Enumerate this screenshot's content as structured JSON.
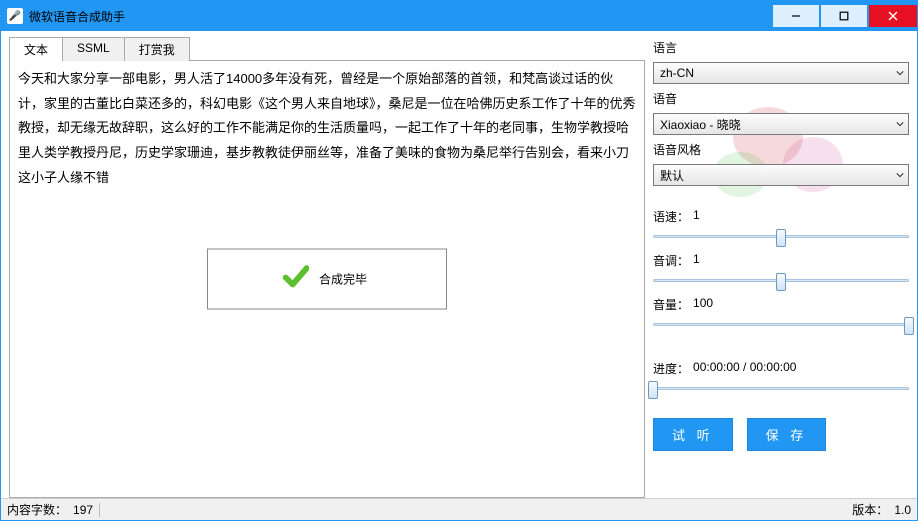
{
  "window": {
    "title": "微软语音合成助手"
  },
  "tabs": {
    "items": [
      "文本",
      "SSML",
      "打赏我"
    ],
    "activeIndex": 0
  },
  "editor": {
    "content": "今天和大家分享一部电影，男人活了14000多年没有死，曾经是一个原始部落的首领，和梵高谈过话的伙计，家里的古董比白菜还多的，科幻电影《这个男人来自地球》，桑尼是一位在哈佛历史系工作了十年的优秀教授，却无缘无故辞职，这么好的工作不能满足你的生活质量吗，一起工作了十年的老同事，生物学教授哈里人类学教授丹尼，历史学家珊迪，基步教教徒伊丽丝等，准备了美味的食物为桑尼举行告别会，看来小刀这小子人缘不错"
  },
  "toast": {
    "message": "合成完毕"
  },
  "sidebar": {
    "language": {
      "label": "语言",
      "value": "zh-CN"
    },
    "voice": {
      "label": "语音",
      "value": "Xiaoxiao - 晓晓"
    },
    "style": {
      "label": "语音风格",
      "value": "默认"
    },
    "rate": {
      "label": "语速：",
      "value": "1",
      "percent": 50
    },
    "pitch": {
      "label": "音调：",
      "value": "1",
      "percent": 50
    },
    "volume": {
      "label": "音量：",
      "value": "100",
      "percent": 100
    },
    "progress": {
      "label": "进度：",
      "value": "00:00:00 / 00:00:00",
      "percent": 0
    },
    "listen_label": "试 听",
    "save_label": "保 存"
  },
  "statusbar": {
    "char_count_label": "内容字数：",
    "char_count_value": "197",
    "version_label": "版本：",
    "version_value": "1.0"
  }
}
